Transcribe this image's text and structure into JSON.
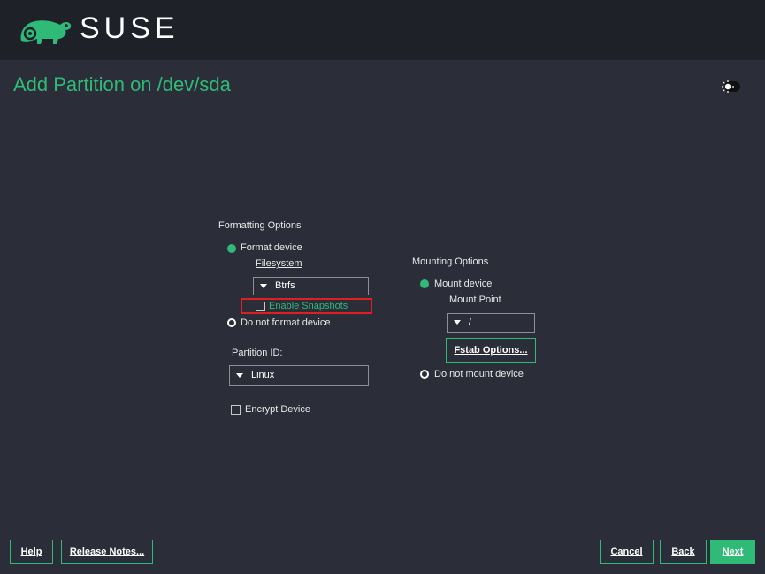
{
  "header": {
    "brand": "SUSE",
    "logo_icon": "suse-chameleon-icon"
  },
  "page": {
    "title": "Add Partition on /dev/sda",
    "theme_toggle_icon": "sun-icon"
  },
  "formatting": {
    "section_label": "Formatting Options",
    "format_device_label": "Format device",
    "format_device_selected": true,
    "filesystem_label": "Filesystem",
    "filesystem_value": "Btrfs",
    "enable_snapshots_label": "Enable Snapshots",
    "enable_snapshots_checked": false,
    "do_not_format_label": "Do not format device",
    "partition_id_label": "Partition ID:",
    "partition_id_value": "Linux",
    "encrypt_label": "Encrypt Device",
    "encrypt_checked": false
  },
  "mounting": {
    "section_label": "Mounting Options",
    "mount_device_label": "Mount device",
    "mount_device_selected": true,
    "mount_point_label": "Mount Point",
    "mount_point_value": "/",
    "fstab_button_label": "Fstab Options...",
    "do_not_mount_label": "Do not mount device"
  },
  "footer": {
    "help_label": "Help",
    "release_notes_label": "Release Notes...",
    "cancel_label": "Cancel",
    "back_label": "Back",
    "next_label": "Next"
  },
  "colors": {
    "accent": "#30ba78",
    "background": "#2b2e38",
    "header": "#1f2128",
    "highlight": "#e02020"
  }
}
